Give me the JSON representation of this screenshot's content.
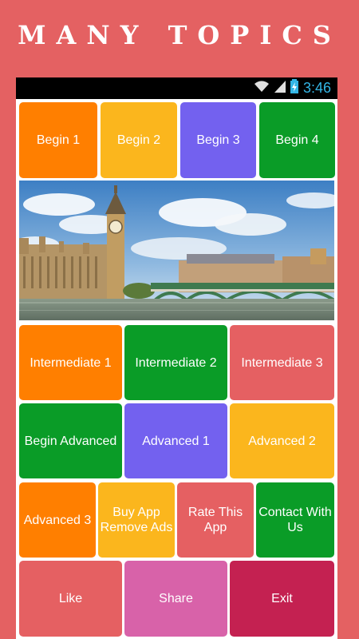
{
  "header": {
    "title": "MANY TOPICS"
  },
  "status_bar": {
    "time": "3:46",
    "icons": [
      "wifi-icon",
      "signal-icon",
      "battery-charging-icon"
    ]
  },
  "banner": {
    "description": "london-skyline-image"
  },
  "rows": {
    "row1": [
      "Begin 1",
      "Begin 2",
      "Begin 3",
      "Begin 4"
    ],
    "row2": [
      "Intermediate 1",
      "Intermediate 2",
      "Intermediate 3"
    ],
    "row3": [
      "Begin Advanced",
      "Advanced 1",
      "Advanced 2"
    ],
    "row4": [
      "Advanced 3",
      "Buy App Remove Ads",
      "Rate This App",
      "Contact With Us"
    ],
    "row5": [
      "Like",
      "Share",
      "Exit"
    ]
  },
  "colors": {
    "background": "#e46162",
    "orange": "#ff7f00",
    "yellow": "#fbb61d",
    "purple": "#7361ef",
    "green": "#0a9c27",
    "salmon": "#e56062",
    "pink": "#d862a9",
    "crimson": "#c42151",
    "clock": "#33b5e5"
  }
}
